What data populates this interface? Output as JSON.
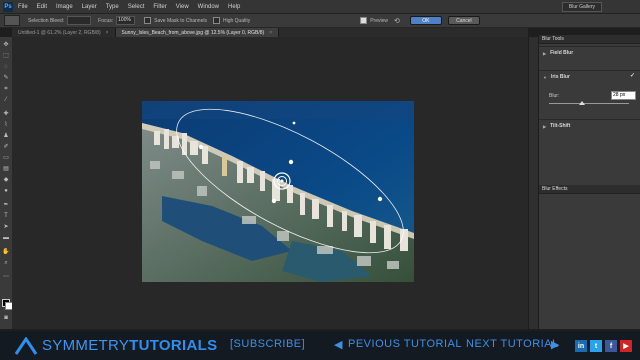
{
  "menubar": {
    "app_logo": "Ps",
    "items": [
      "File",
      "Edit",
      "Image",
      "Layer",
      "Type",
      "Select",
      "Filter",
      "View",
      "Window",
      "Help"
    ],
    "workspace": "Blur Gallery"
  },
  "options": {
    "selection_bleed_label": "Selection Bleed:",
    "focus_label": "Focus:",
    "focus_value": "100%",
    "save_mask_label": "Save Mask to Channels",
    "high_quality_label": "High Quality",
    "preview_label": "Preview",
    "ok_label": "OK",
    "cancel_label": "Cancel"
  },
  "tabs": [
    {
      "label": "Untitled-1 @ 61.2% (Layer 2, RGB/8)",
      "active": false
    },
    {
      "label": "Sunny_Isles_Beach_from_above.jpg @ 12.5% (Layer 0, RGB/8)",
      "active": true
    }
  ],
  "panel": {
    "tools_title": "Blur Tools",
    "sections": [
      {
        "label": "Field Blur",
        "checked": false
      },
      {
        "label": "Iris Blur",
        "checked": true
      },
      {
        "label": "Tilt-Shift",
        "checked": false
      }
    ],
    "blur_label": "Blur:",
    "blur_value": "28 px",
    "effects_title": "Blur Effects"
  },
  "brand": {
    "name_part1": "SYMMETRY",
    "name_part2": "TUTORIALS",
    "subscribe": "[SUBSCRIBE]",
    "previous": "PEVIOUS TUTORIAL",
    "next": "NEXT TUTORIAL",
    "social": [
      {
        "icon": "linkedin-icon",
        "glyph": "in",
        "color": "#1a6bb0"
      },
      {
        "icon": "twitter-icon",
        "glyph": "t",
        "color": "#2aa3ef"
      },
      {
        "icon": "facebook-icon",
        "glyph": "f",
        "color": "#3b5998"
      },
      {
        "icon": "youtube-icon",
        "glyph": "▶",
        "color": "#d32424"
      }
    ]
  },
  "colors": {
    "accent": "#2f8ff0",
    "ok_button": "#4f7fc4"
  }
}
